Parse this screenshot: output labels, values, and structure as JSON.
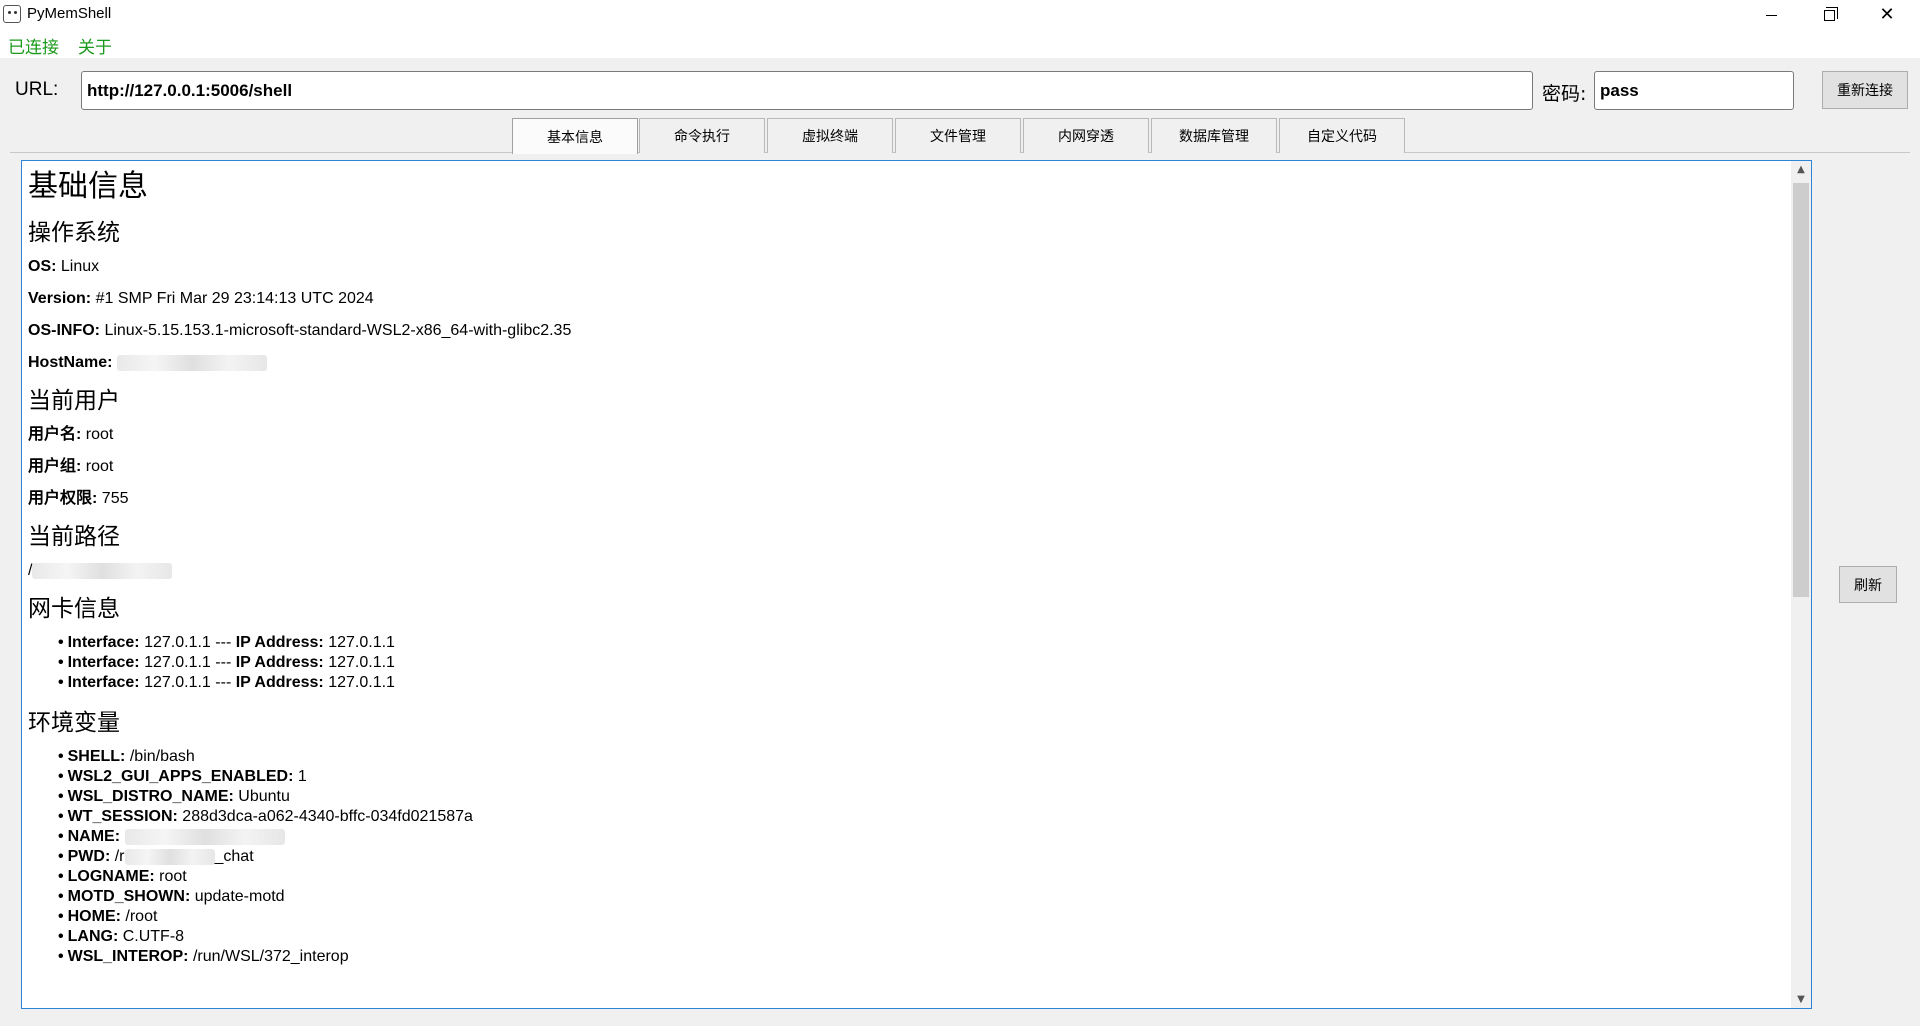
{
  "window": {
    "title": "PyMemShell",
    "minimize_glyph": "",
    "close_glyph": "✕"
  },
  "menu": {
    "items": [
      "已连接",
      "关于"
    ]
  },
  "connection": {
    "url_label": "URL:",
    "url_value": "http://127.0.0.1:5006/shell",
    "password_label": "密码:",
    "password_value": "pass",
    "reconnect_label": "重新连接"
  },
  "tabs": [
    "基本信息",
    "命令执行",
    "虚拟终端",
    "文件管理",
    "内网穿透",
    "数据库管理",
    "自定义代码"
  ],
  "active_tab": "基本信息",
  "refresh_label": "刷新",
  "info": {
    "title": "基础信息",
    "os_section": {
      "heading": "操作系统",
      "os_key": "OS:",
      "os_val": "Linux",
      "version_key": "Version:",
      "version_val": "#1 SMP Fri Mar 29 23:14:13 UTC 2024",
      "osinfo_key": "OS-INFO:",
      "osinfo_val": "Linux-5.15.153.1-microsoft-standard-WSL2-x86_64-with-glibc2.35",
      "hostname_key": "HostName:"
    },
    "user_section": {
      "heading": "当前用户",
      "username_key": "用户名:",
      "username_val": "root",
      "group_key": "用户组:",
      "group_val": "root",
      "perm_key": "用户权限:",
      "perm_val": "755"
    },
    "path_section": {
      "heading": "当前路径",
      "path_prefix": "/"
    },
    "nic_section": {
      "heading": "网卡信息",
      "interfaces": [
        {
          "iface_key": "Interface:",
          "iface_val": "127.0.1.1",
          "sep": "---",
          "ip_key": "IP Address:",
          "ip_val": "127.0.1.1"
        },
        {
          "iface_key": "Interface:",
          "iface_val": "127.0.1.1",
          "sep": "---",
          "ip_key": "IP Address:",
          "ip_val": "127.0.1.1"
        },
        {
          "iface_key": "Interface:",
          "iface_val": "127.0.1.1",
          "sep": "---",
          "ip_key": "IP Address:",
          "ip_val": "127.0.1.1"
        }
      ]
    },
    "env_section": {
      "heading": "环境变量",
      "vars": [
        {
          "key": "SHELL:",
          "val": "/bin/bash"
        },
        {
          "key": "WSL2_GUI_APPS_ENABLED:",
          "val": "1"
        },
        {
          "key": "WSL_DISTRO_NAME:",
          "val": "Ubuntu"
        },
        {
          "key": "WT_SESSION:",
          "val": "288d3dca-a062-4340-bffc-034fd021587a"
        },
        {
          "key": "NAME:",
          "val": ""
        },
        {
          "key": "PWD:",
          "val": "/r",
          "suffix": "_chat"
        },
        {
          "key": "LOGNAME:",
          "val": "root"
        },
        {
          "key": "MOTD_SHOWN:",
          "val": "update-motd"
        },
        {
          "key": "HOME:",
          "val": "/root"
        },
        {
          "key": "LANG:",
          "val": "C.UTF-8"
        },
        {
          "key": "WSL_INTEROP:",
          "val": "/run/WSL/372_interop"
        }
      ]
    }
  }
}
